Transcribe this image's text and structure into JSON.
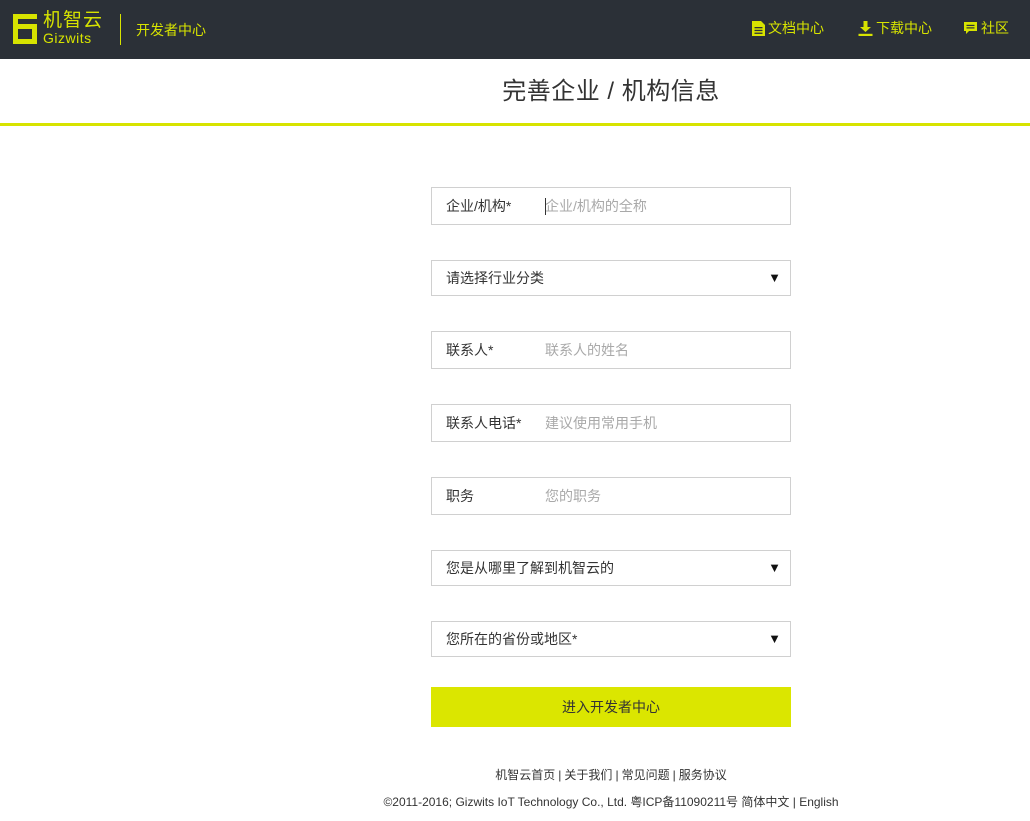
{
  "header": {
    "logo_cn": "机智云",
    "logo_en": "Gizwits",
    "portal_title": "开发者中心",
    "nav": [
      {
        "label": "文档中心",
        "icon": "document-icon"
      },
      {
        "label": "下载中心",
        "icon": "download-icon"
      },
      {
        "label": "社区",
        "icon": "chat-bubble-icon"
      }
    ]
  },
  "page": {
    "title": "完善企业 / 机构信息"
  },
  "form": {
    "company": {
      "label": "企业/机构*",
      "placeholder": "企业/机构的全称",
      "value": ""
    },
    "industry": {
      "selected": "请选择行业分类"
    },
    "contact": {
      "label": "联系人*",
      "placeholder": "联系人的姓名",
      "value": ""
    },
    "phone": {
      "label": "联系人电话*",
      "placeholder": "建议使用常用手机",
      "value": ""
    },
    "position": {
      "label": "职务",
      "placeholder": "您的职务",
      "value": ""
    },
    "source": {
      "selected": "您是从哪里了解到机智云的"
    },
    "region": {
      "selected": "您所在的省份或地区*"
    },
    "arrow": "▼",
    "submit_label": "进入开发者中心"
  },
  "footer": {
    "links": [
      "机智云首页",
      "关于我们",
      "常见问题",
      "服务协议"
    ],
    "separator": "|",
    "copyright": "©2011-2016; Gizwits IoT Technology Co., Ltd. 粤ICP备11090211号",
    "lang_cn": "简体中文",
    "lang_en": "English"
  },
  "colors": {
    "header_bg": "#2b3037",
    "accent": "#d7e300",
    "button_bg": "#dbe600",
    "border": "#d0d0d0"
  }
}
